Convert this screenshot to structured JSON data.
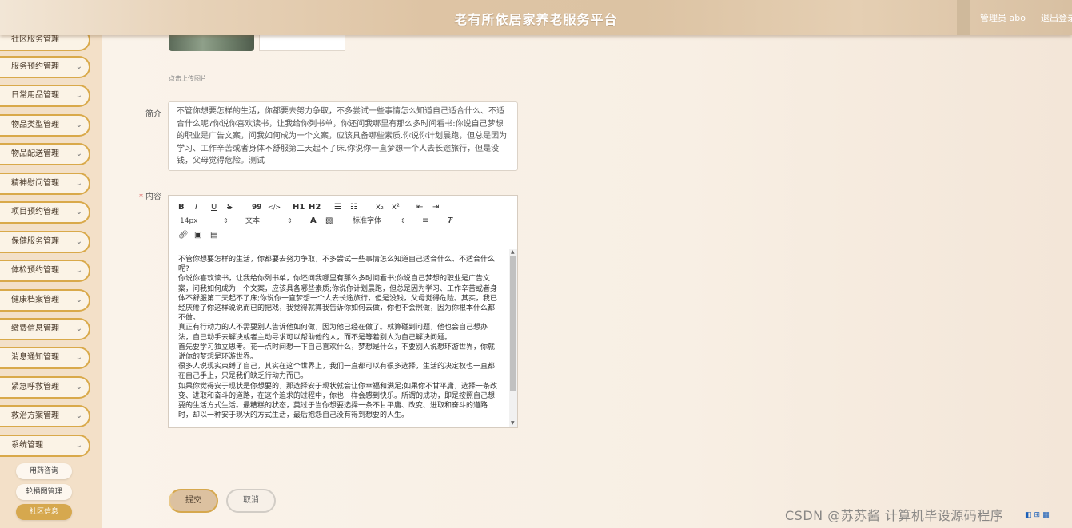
{
  "header": {
    "title": "老有所依居家养老服务平台",
    "user": "管理员 abo",
    "logout": "退出登录"
  },
  "sidebar": {
    "partial_top_label": "社区服务管理",
    "items": [
      {
        "label": "服务预约管理"
      },
      {
        "label": "日常用品管理"
      },
      {
        "label": "物品类型管理"
      },
      {
        "label": "物品配送管理"
      },
      {
        "label": "精神慰问管理"
      },
      {
        "label": "项目预约管理"
      },
      {
        "label": "保健服务管理"
      },
      {
        "label": "体检预约管理"
      },
      {
        "label": "健康档案管理"
      },
      {
        "label": "缴费信息管理"
      },
      {
        "label": "消息通知管理"
      },
      {
        "label": "紧急呼救管理"
      },
      {
        "label": "救治方案管理"
      },
      {
        "label": "系统管理"
      }
    ],
    "sub_items": [
      {
        "label": "用药咨询",
        "active": false
      },
      {
        "label": "轮播图管理",
        "active": false
      },
      {
        "label": "社区信息",
        "active": true
      }
    ],
    "chevron_icon": "chevron-down-icon"
  },
  "form": {
    "upload_hint": "点击上传图片",
    "intro_label": "简介",
    "intro_value": "不管你想要怎样的生活，你都要去努力争取，不多尝试一些事情怎么知道自己适合什么、不适合什么呢?你说你喜欢读书，让我给你列书单，你还问我哪里有那么多时间看书:你说自己梦想的职业是广告文案，问我如何成为一个文案，应该具备哪些素质.你说你计划晨跑，但总是因为学习、工作辛苦或者身体不舒服第二天起不了床.你说你一直梦想一个人去长途旅行，但是没钱，父母觉得危险。测试",
    "content_label": "内容",
    "toolbar": {
      "bold": "B",
      "italic": "I",
      "underline": "U",
      "strike": "S",
      "quote": "99",
      "code": "</>",
      "h1": "H1",
      "h2": "H2",
      "sub": "x₂",
      "sup": "x²",
      "size": "14px",
      "text_type": "文本",
      "font": "标准字体"
    },
    "editor_paragraphs": [
      "不管你想要怎样的生活，你都要去努力争取，不多尝试一些事情怎么知道自己适合什么、不适合什么呢?",
      "你说你喜欢读书，让我给你列书单，你还问我哪里有那么多时间看书;你说自己梦想的职业是广告文案，问我如何成为一个文案，应该具备哪些素质;你说你计划晨跑，但总是因为学习、工作辛苦或者身体不舒服第二天起不了床;你说你一直梦想一个人去长途旅行，但是没钱，父母觉得危险。其实，我已经厌倦了你这样说说而已的把戏，我觉得就算我告诉你如何去做，你也不会照做，因为你根本什么都不做。",
      "真正有行动力的人不需要别人告诉他如何做，因为他已经在做了。就算碰到问题，他也会自己想办法，自己动手去解决或者主动寻求可以帮助他的人，而不是等着别人为自己解决问题。",
      "首先要学习独立思考。花一点时间想一下自己喜欢什么，梦想是什么，不要别人说想环游世界，你就说你的梦想是环游世界。",
      "很多人说现实束缚了自己，其实在这个世界上，我们一直都可以有很多选择，生活的决定权也一直都在自己手上，只是我们缺乏行动力而已。",
      "如果你觉得安于现状是你想要的，那选择安于现状就会让你幸福和满足;如果你不甘平庸，选择一条改变、进取和奋斗的道路，在这个追求的过程中，你也一样会感到快乐。所谓的成功，即是按照自己想要的生活方式生活。最糟糕的状态，莫过于当你想要选择一条不甘平庸、改变、进取和奋斗的道路时，却以一种安于现状的方式生活，最后抱怨自己没有得到想要的人生。"
    ],
    "submit": "提交",
    "cancel": "取消"
  },
  "watermark": "CSDN @苏苏酱   计算机毕设源码程序"
}
